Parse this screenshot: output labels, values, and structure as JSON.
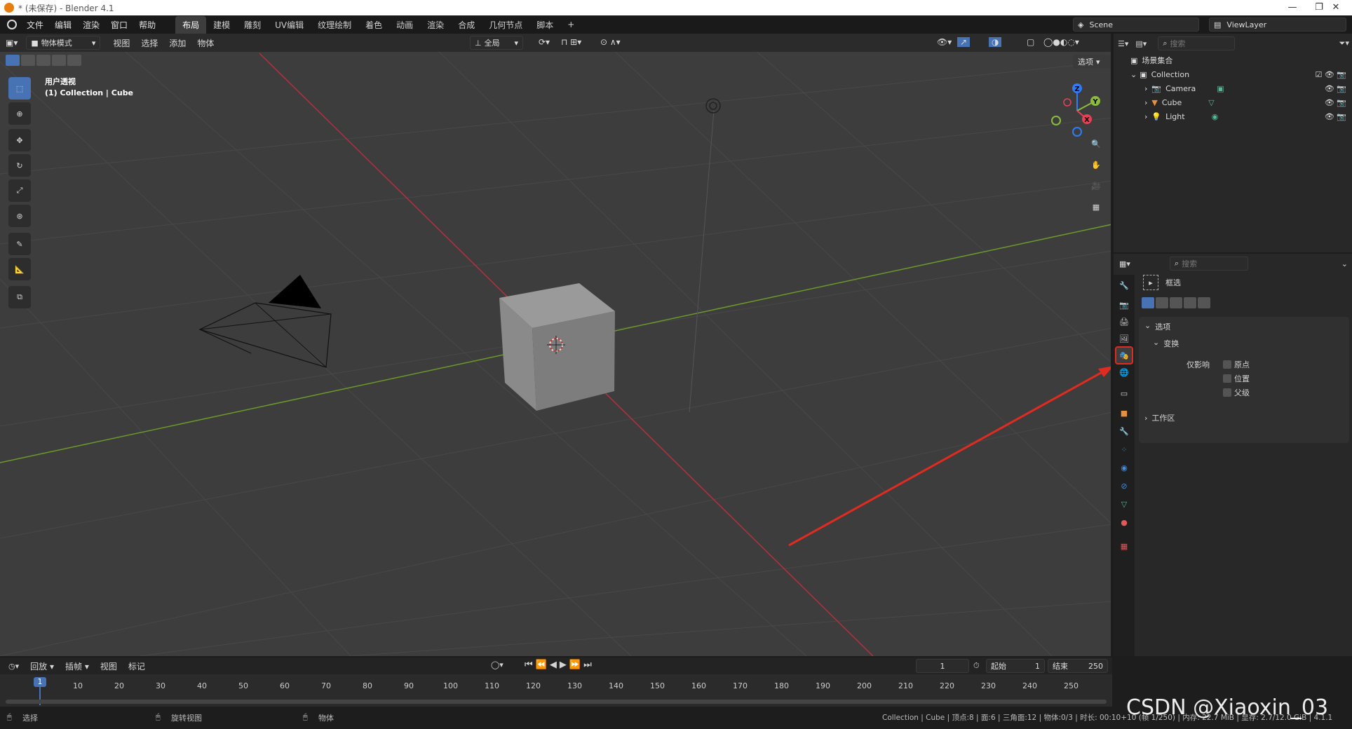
{
  "window": {
    "title": "* (未保存) - Blender 4.1",
    "min": "—",
    "max": "❐",
    "close": "✕"
  },
  "menus": [
    "文件",
    "编辑",
    "渲染",
    "窗口",
    "帮助"
  ],
  "workspaces": [
    "布局",
    "建模",
    "雕刻",
    "UV编辑",
    "纹理绘制",
    "着色",
    "动画",
    "渲染",
    "合成",
    "几何节点",
    "脚本"
  ],
  "scene": {
    "scene_name": "Scene",
    "view_layer": "ViewLayer"
  },
  "viewport": {
    "mode": "物体模式",
    "menus": [
      "视图",
      "选择",
      "添加",
      "物体"
    ],
    "transform": "全局",
    "overlay_label": "用户透视",
    "collection_label": "(1) Collection | Cube",
    "options": "选项",
    "axes": {
      "x": "X",
      "y": "Y",
      "z": "Z"
    }
  },
  "outliner": {
    "search_placeholder": "搜索",
    "root": "场景集合",
    "collection": "Collection",
    "items": [
      "Camera",
      "Cube",
      "Light"
    ]
  },
  "properties": {
    "search_placeholder": "搜索",
    "tool_name": "框选",
    "section_options": "选项",
    "section_transform": "变换",
    "affect_only": "仅影响",
    "checks": [
      "原点",
      "位置",
      "父级"
    ],
    "section_workspace": "工作区"
  },
  "timeline": {
    "menus": [
      "回放",
      "插帧",
      "视图",
      "标记"
    ],
    "current_frame": "1",
    "start_label": "起始",
    "start": "1",
    "end_label": "结束",
    "end": "250",
    "ticks": [
      "10",
      "20",
      "30",
      "40",
      "50",
      "60",
      "70",
      "80",
      "90",
      "100",
      "110",
      "120",
      "130",
      "140",
      "150",
      "160",
      "170",
      "180",
      "190",
      "200",
      "210",
      "220",
      "230",
      "240",
      "250"
    ]
  },
  "status": {
    "select": "选择",
    "rotate": "旋转视图",
    "object": "物体",
    "info": "Collection | Cube | 顶点:8 | 面:6 | 三角面:12 | 物体:0/3 | 时长: 00:10+10 (帧 1/250) | 内存: 22.7 MiB | 显存: 2.7/12.0 GiB | 4.1.1",
    "watermark": "CSDN @Xiaoxin_03"
  }
}
